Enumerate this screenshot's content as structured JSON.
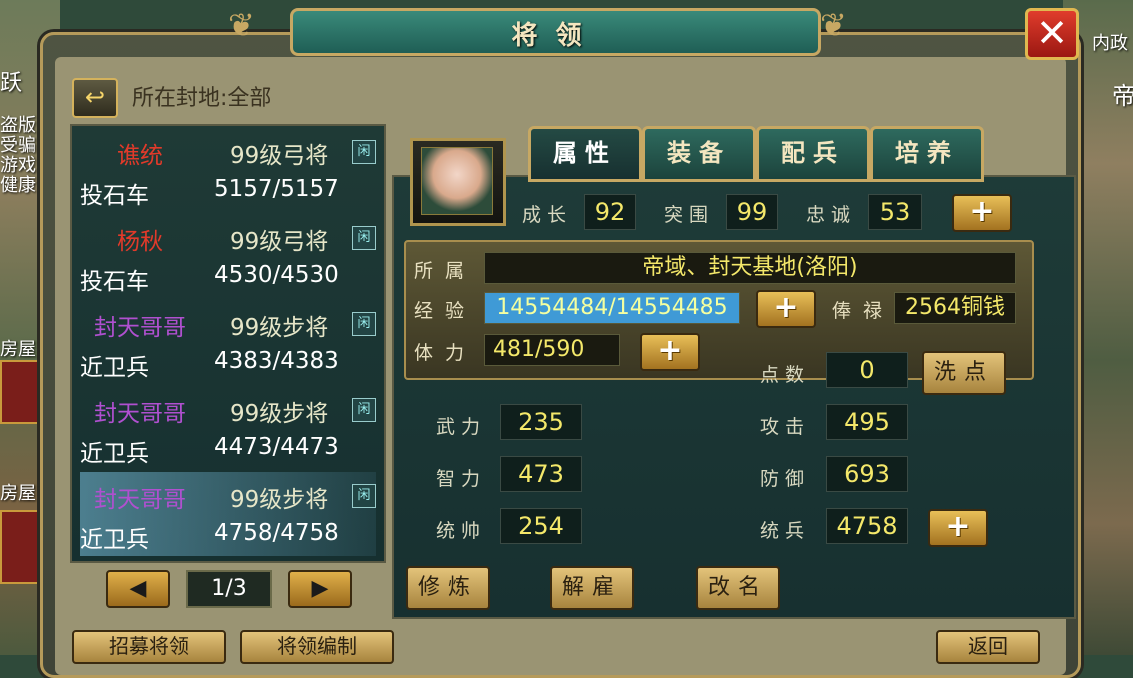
{
  "title": "将领",
  "close_symbol": "✕",
  "side": {
    "left_texts": [
      "跃",
      "盗版",
      "受骗",
      "游戏",
      "健康",
      "房屋",
      "房屋"
    ],
    "right_texts": [
      "内政",
      "帝"
    ]
  },
  "fief": {
    "back_icon": "↩",
    "label": "所在封地:全部"
  },
  "generals": [
    {
      "name": "谯统",
      "name_color": "#e23a2a",
      "level": "99级弓将",
      "tag": "闲",
      "unit": "投石车",
      "count": "5157/5157"
    },
    {
      "name": "杨秋",
      "name_color": "#e23a2a",
      "level": "99级弓将",
      "tag": "闲",
      "unit": "投石车",
      "count": "4530/4530"
    },
    {
      "name": "封天哥哥",
      "name_color": "#b050d0",
      "level": "99级步将",
      "tag": "闲",
      "unit": "近卫兵",
      "count": "4383/4383"
    },
    {
      "name": "封天哥哥",
      "name_color": "#b050d0",
      "level": "99级步将",
      "tag": "闲",
      "unit": "近卫兵",
      "count": "4473/4473"
    },
    {
      "name": "封天哥哥",
      "name_color": "#b050d0",
      "level": "99级步将",
      "tag": "闲",
      "unit": "近卫兵",
      "count": "4758/4758"
    }
  ],
  "pager": {
    "prev": "◀",
    "page": "1/3",
    "next": "▶"
  },
  "tabs": [
    "属性",
    "装备",
    "配兵",
    "培养"
  ],
  "top_stats": {
    "growth_label": "成长",
    "growth": "92",
    "siege_label": "突围",
    "siege": "99",
    "loyalty_label": "忠诚",
    "loyalty": "53"
  },
  "plus": "+",
  "info": {
    "belong_label": "所属",
    "belong": "帝域、封天基地(洛阳)",
    "exp_label": "经验",
    "exp": "14554484/14554485",
    "salary_label": "俸禄",
    "salary": "2564铜钱",
    "stamina_label": "体力",
    "stamina": "481/590"
  },
  "points": {
    "label": "点数",
    "value": "0",
    "reset_button": "洗点"
  },
  "attrs": {
    "force_label": "武力",
    "force": "235",
    "intel_label": "智力",
    "intel": "473",
    "lead_label": "统帅",
    "lead": "254",
    "attack_label": "攻击",
    "attack": "495",
    "defense_label": "防御",
    "defense": "693",
    "troops_label": "统兵",
    "troops": "4758"
  },
  "actions": {
    "train": "修炼",
    "dismiss": "解雇",
    "rename": "改名"
  },
  "bottom_buttons": [
    "招募将领",
    "将领编制",
    "返回"
  ]
}
